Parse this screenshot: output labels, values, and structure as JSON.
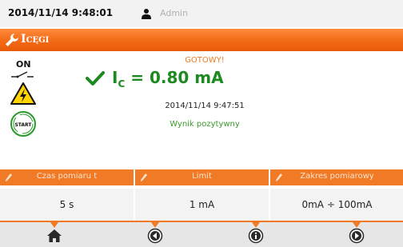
{
  "status_bar": {
    "datetime": "2014/11/14 9:48:01",
    "user_icon": "user-icon",
    "user": "Admin"
  },
  "title_bar": {
    "icon": "wrench-icon",
    "title_big": "I",
    "title_small": "CĘGI"
  },
  "left_panel": {
    "state_label": "ON",
    "icons": [
      "switch-icon",
      "high-voltage-warning-icon",
      "start-button"
    ],
    "start_label": "START"
  },
  "result": {
    "status": "GOTOWY!",
    "check_icon": "checkmark-icon",
    "measurement_symbol": "I",
    "measurement_sub": "C",
    "measurement_value": " = 0.80 mA",
    "timestamp": "2014/11/14 9:47:51",
    "verdict": "Wynik pozytywny"
  },
  "parameters": [
    {
      "label": "Czas pomiaru t",
      "value": "5 s"
    },
    {
      "label": "Limit",
      "value": "1 mA"
    },
    {
      "label": "Zakres pomiarowy",
      "value": "0mA ÷ 100mA"
    }
  ],
  "nav": {
    "buttons": [
      "home-icon",
      "back-icon",
      "info-icon",
      "forward-icon"
    ]
  },
  "colors": {
    "accent": "#f07a25",
    "success": "#1d8a20",
    "status_bar": "#f2f2f2"
  }
}
